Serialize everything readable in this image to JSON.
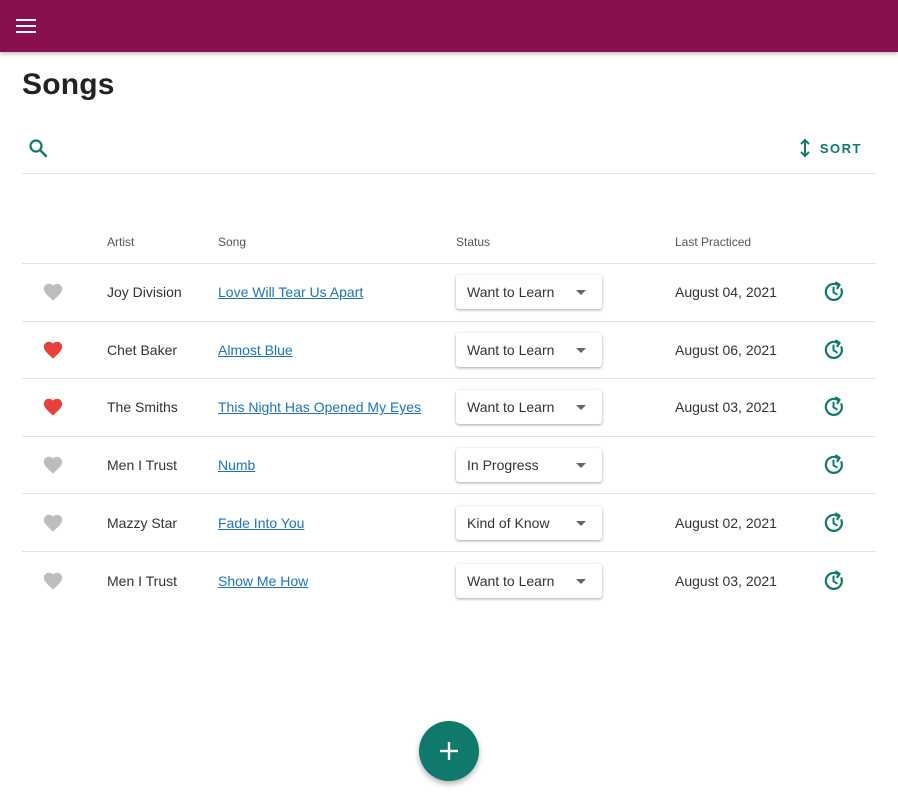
{
  "colors": {
    "appbar": "#8a0f4e",
    "accent": "#0f7a6c",
    "link": "#1e73be",
    "heart_on": "#e8413c",
    "heart_off": "#bdbdbd"
  },
  "appbar": {
    "menu_icon": "menu-icon"
  },
  "page": {
    "title": "Songs"
  },
  "toolbar": {
    "search_icon": "search-icon",
    "sort_icon": "vertical-arrows-icon",
    "sort_label": "SORT"
  },
  "table": {
    "headers": {
      "artist": "Artist",
      "song": "Song",
      "status": "Status",
      "last_practiced": "Last Practiced"
    },
    "rows": [
      {
        "favorite": false,
        "artist": "Joy Division",
        "song": "Love Will Tear Us Apart",
        "status": "Want to Learn",
        "last_practiced": "August 04, 2021"
      },
      {
        "favorite": true,
        "artist": "Chet Baker",
        "song": "Almost Blue",
        "status": "Want to Learn",
        "last_practiced": "August 06, 2021"
      },
      {
        "favorite": true,
        "artist": "The Smiths",
        "song": "This Night Has Opened My Eyes",
        "status": "Want to Learn",
        "last_practiced": "August 03, 2021"
      },
      {
        "favorite": false,
        "artist": "Men I Trust",
        "song": "Numb",
        "status": "In Progress",
        "last_practiced": ""
      },
      {
        "favorite": false,
        "artist": "Mazzy Star",
        "song": "Fade Into You",
        "status": "Kind of Know",
        "last_practiced": "August 02, 2021"
      },
      {
        "favorite": false,
        "artist": "Men I Trust",
        "song": "Show Me How",
        "status": "Want to Learn",
        "last_practiced": "August 03, 2021"
      }
    ]
  },
  "fab": {
    "icon": "plus-icon"
  }
}
